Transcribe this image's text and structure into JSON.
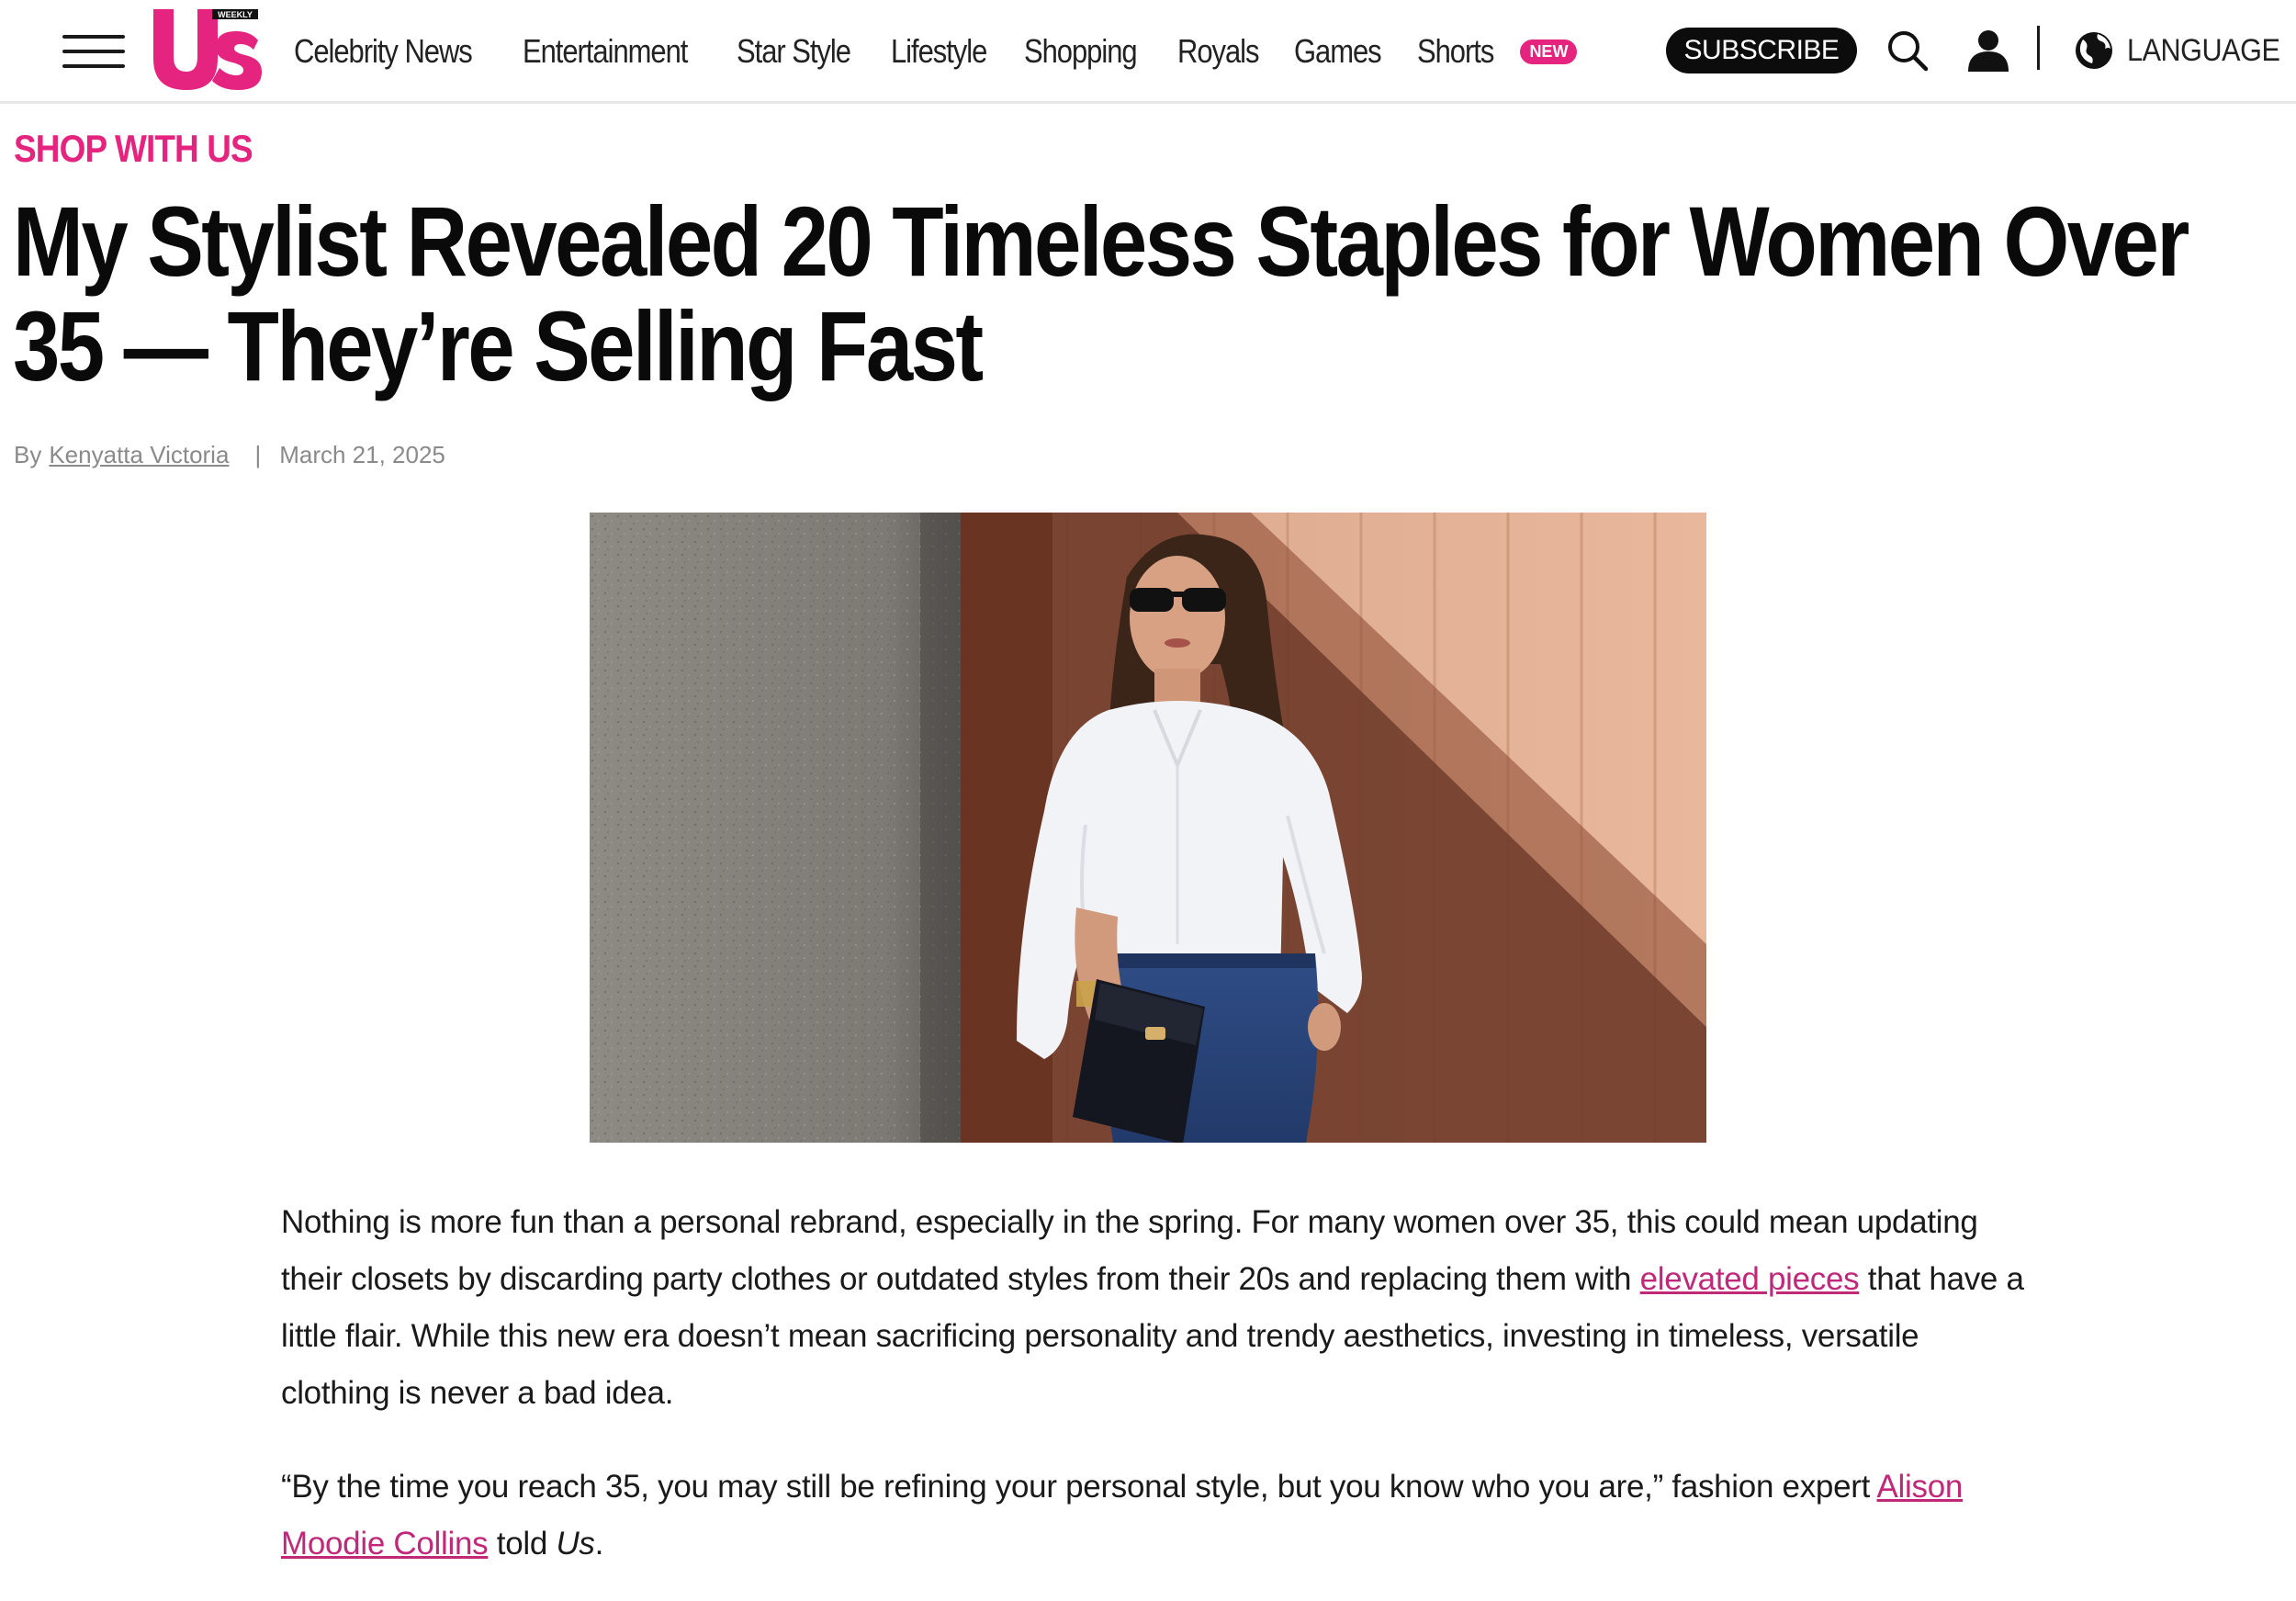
{
  "header": {
    "logo_text": "Us",
    "logo_tag": "WEEKLY",
    "nav": [
      {
        "label": "Celebrity News"
      },
      {
        "label": "Entertainment"
      },
      {
        "label": "Star Style"
      },
      {
        "label": "Lifestyle"
      },
      {
        "label": "Shopping"
      },
      {
        "label": "Royals"
      },
      {
        "label": "Games"
      },
      {
        "label": "Shorts",
        "badge": "NEW"
      }
    ],
    "subscribe_label": "SUBSCRIBE",
    "language_label": "LANGUAGE",
    "icons": [
      "menu-icon",
      "search-icon",
      "user-icon",
      "globe-icon"
    ]
  },
  "article": {
    "kicker": "SHOP WITH US",
    "headline": "My Stylist Revealed 20 Timeless Staples for Women Over 35 — They’re Selling Fast",
    "byline_prefix": "By",
    "author": "Kenyatta Victoria",
    "date": "March 21, 2025",
    "paragraph1": {
      "before": "Nothing is more fun than a personal rebrand, especially in the spring. For many women over 35, this could mean updating their closets by discarding party clothes or outdated styles from their 20s and replacing them with ",
      "link": "elevated pieces",
      "after": " that have a little flair. While this new era doesn’t mean sacrificing personality and trendy aesthetics, investing in timeless, versatile clothing is never a bad idea."
    },
    "paragraph2": {
      "before": "“By the time you reach 35, you may still be refining your personal style, but you know who you are,” fashion expert ",
      "link": "Alison Moodie Collins",
      "middle": " told ",
      "em": "Us",
      "after": "."
    }
  },
  "colors": {
    "brand_pink": "#e4247f",
    "link_pink": "#c0287a",
    "subscribe_bg": "#0c0c0c"
  }
}
